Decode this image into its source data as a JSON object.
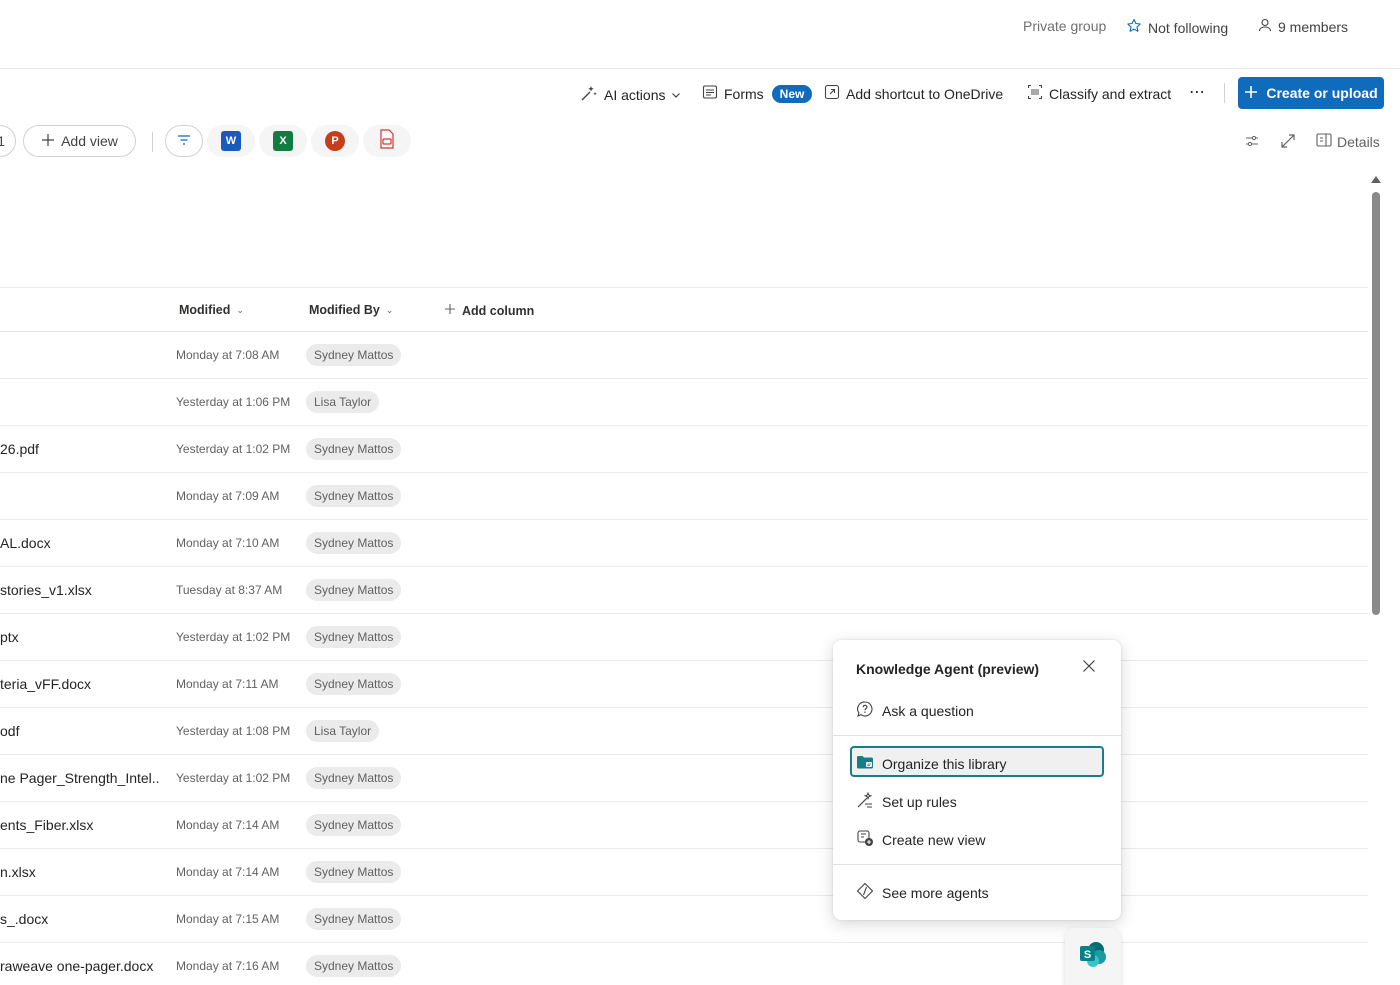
{
  "top_bar": {
    "privacy": "Private group",
    "follow_label": "Not following",
    "members_label": "9 members"
  },
  "command_bar": {
    "ai_actions": "AI actions",
    "forms": "Forms",
    "forms_badge": "New",
    "add_shortcut": "Add shortcut to OneDrive",
    "classify": "Classify and extract",
    "more": "⋯",
    "create_upload": "Create or upload"
  },
  "views_bar": {
    "partial_view_label": "1",
    "add_view": "Add view",
    "apps": [
      {
        "name": "word",
        "glyph": "W",
        "color": "#185abd"
      },
      {
        "name": "excel",
        "glyph": "X",
        "color": "#107c41"
      },
      {
        "name": "powerpoint",
        "glyph": "P",
        "color": "#c43e1c"
      },
      {
        "name": "pdf",
        "glyph": "",
        "color": "#d13438"
      }
    ],
    "details": "Details"
  },
  "list": {
    "columns": {
      "modified": "Modified",
      "modified_by": "Modified By",
      "add_column": "Add column"
    },
    "rows": [
      {
        "name": "",
        "modified": "Monday at 7:08 AM",
        "modified_by": "Sydney Mattos"
      },
      {
        "name": "",
        "modified": "Yesterday at 1:06 PM",
        "modified_by": "Lisa Taylor"
      },
      {
        "name": "26.pdf",
        "modified": "Yesterday at 1:02 PM",
        "modified_by": "Sydney Mattos"
      },
      {
        "name": "",
        "modified": "Monday at 7:09 AM",
        "modified_by": "Sydney Mattos"
      },
      {
        "name": "AL.docx",
        "modified": "Monday at 7:10 AM",
        "modified_by": "Sydney Mattos"
      },
      {
        "name": " stories_v1.xlsx",
        "modified": "Tuesday at 8:37 AM",
        "modified_by": "Sydney Mattos"
      },
      {
        "name": "ptx",
        "modified": "Yesterday at 1:02 PM",
        "modified_by": "Sydney Mattos"
      },
      {
        "name": "teria_vFF.docx",
        "modified": "Monday at 7:11 AM",
        "modified_by": "Sydney Mattos"
      },
      {
        "name": "odf",
        "modified": "Yesterday at 1:08 PM",
        "modified_by": "Lisa Taylor"
      },
      {
        "name": "ne Pager_Strength_Intel...",
        "modified": "Yesterday at 1:02 PM",
        "modified_by": "Sydney Mattos"
      },
      {
        "name": "ents_Fiber.xlsx",
        "modified": "Monday at 7:14 AM",
        "modified_by": "Sydney Mattos"
      },
      {
        "name": "n.xlsx",
        "modified": "Monday at 7:14 AM",
        "modified_by": "Sydney Mattos"
      },
      {
        "name": "s_.docx",
        "modified": "Monday at 7:15 AM",
        "modified_by": "Sydney Mattos"
      },
      {
        "name": "raweave one-pager.docx",
        "modified": "Monday at 7:16 AM",
        "modified_by": "Sydney Mattos"
      }
    ]
  },
  "agent_panel": {
    "title": "Knowledge Agent (preview)",
    "ask": "Ask a question",
    "organize": "Organize this library",
    "rules": "Set up rules",
    "new_view": "Create new view",
    "more_agents": "See more agents"
  },
  "colors": {
    "accent": "#0f6cbd",
    "agent_focus": "#197c86",
    "sharepoint": "#038387"
  }
}
